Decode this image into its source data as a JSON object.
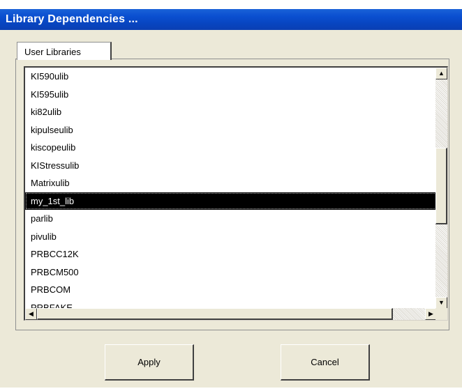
{
  "window": {
    "title": "Library Dependencies ..."
  },
  "tabs": [
    {
      "label": "User Libraries"
    }
  ],
  "list": {
    "items": [
      "KI590ulib",
      "KI595ulib",
      "ki82ulib",
      "kipulseulib",
      "kiscopeulib",
      "KIStressulib",
      "Matrixulib",
      "my_1st_lib",
      "parlib",
      "pivulib",
      "PRBCC12K",
      "PRBCM500",
      "PRBCOM",
      "PRBFAKE"
    ],
    "selected": "my_1st_lib"
  },
  "scrollbar": {
    "up_icon": "arrow-up",
    "down_icon": "arrow-down",
    "left_icon": "arrow-left",
    "right_icon": "arrow-right"
  },
  "buttons": {
    "apply": "Apply",
    "cancel": "Cancel"
  },
  "colors": {
    "titlebar": "#0a4fd0",
    "dialog_bg": "#ece9d8",
    "selection_bg": "#000000"
  }
}
